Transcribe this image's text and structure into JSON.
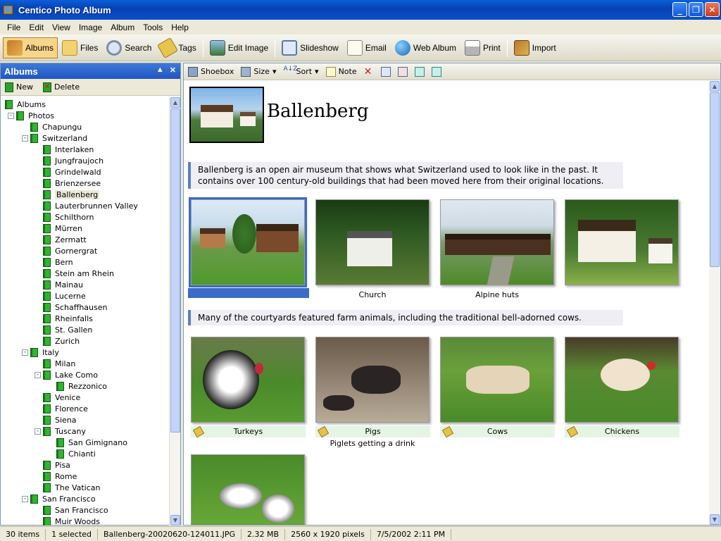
{
  "window": {
    "title": "Centico Photo Album"
  },
  "menu": [
    "File",
    "Edit",
    "View",
    "Image",
    "Album",
    "Tools",
    "Help"
  ],
  "toolbar": {
    "albums": "Albums",
    "files": "Files",
    "search": "Search",
    "tags": "Tags",
    "edit_image": "Edit Image",
    "slideshow": "Slideshow",
    "email": "Email",
    "web_album": "Web Album",
    "print": "Print",
    "import": "Import"
  },
  "left_pane": {
    "title": "Albums",
    "new_label": "New",
    "delete_label": "Delete",
    "tree": [
      {
        "label": "Albums",
        "level": 0,
        "toggle": ""
      },
      {
        "label": "Photos",
        "level": 1,
        "toggle": "-"
      },
      {
        "label": "Chapungu",
        "level": 2,
        "toggle": ""
      },
      {
        "label": "Switzerland",
        "level": 2,
        "toggle": "-"
      },
      {
        "label": "Interlaken",
        "level": 3,
        "toggle": ""
      },
      {
        "label": "Jungfraujoch",
        "level": 3,
        "toggle": ""
      },
      {
        "label": "Grindelwald",
        "level": 3,
        "toggle": ""
      },
      {
        "label": "Brienzersee",
        "level": 3,
        "toggle": ""
      },
      {
        "label": "Ballenberg",
        "level": 3,
        "toggle": "",
        "selected": true
      },
      {
        "label": "Lauterbrunnen Valley",
        "level": 3,
        "toggle": ""
      },
      {
        "label": "Schilthorn",
        "level": 3,
        "toggle": ""
      },
      {
        "label": "Mürren",
        "level": 3,
        "toggle": ""
      },
      {
        "label": "Zermatt",
        "level": 3,
        "toggle": ""
      },
      {
        "label": "Gornergrat",
        "level": 3,
        "toggle": ""
      },
      {
        "label": "Bern",
        "level": 3,
        "toggle": ""
      },
      {
        "label": "Stein am Rhein",
        "level": 3,
        "toggle": ""
      },
      {
        "label": "Mainau",
        "level": 3,
        "toggle": ""
      },
      {
        "label": "Lucerne",
        "level": 3,
        "toggle": ""
      },
      {
        "label": "Schaffhausen",
        "level": 3,
        "toggle": ""
      },
      {
        "label": "Rheinfalls",
        "level": 3,
        "toggle": ""
      },
      {
        "label": "St. Gallen",
        "level": 3,
        "toggle": ""
      },
      {
        "label": "Zurich",
        "level": 3,
        "toggle": ""
      },
      {
        "label": "Italy",
        "level": 2,
        "toggle": "-"
      },
      {
        "label": "Milan",
        "level": 3,
        "toggle": ""
      },
      {
        "label": "Lake Como",
        "level": 3,
        "toggle": "-"
      },
      {
        "label": "Rezzonico",
        "level": 4,
        "toggle": ""
      },
      {
        "label": "Venice",
        "level": 3,
        "toggle": ""
      },
      {
        "label": "Florence",
        "level": 3,
        "toggle": ""
      },
      {
        "label": "Siena",
        "level": 3,
        "toggle": ""
      },
      {
        "label": "Tuscany",
        "level": 3,
        "toggle": "-"
      },
      {
        "label": "San Gimignano",
        "level": 4,
        "toggle": ""
      },
      {
        "label": "Chianti",
        "level": 4,
        "toggle": ""
      },
      {
        "label": "Pisa",
        "level": 3,
        "toggle": ""
      },
      {
        "label": "Rome",
        "level": 3,
        "toggle": ""
      },
      {
        "label": "The Vatican",
        "level": 3,
        "toggle": ""
      },
      {
        "label": "San Francisco",
        "level": 2,
        "toggle": "-"
      },
      {
        "label": "San Francisco",
        "level": 3,
        "toggle": ""
      },
      {
        "label": "Muir Woods",
        "level": 3,
        "toggle": ""
      }
    ]
  },
  "right_toolbar": {
    "shoebox": "Shoebox",
    "size": "Size",
    "sort": "Sort",
    "note": "Note"
  },
  "album": {
    "title": "Ballenberg",
    "note1": "Ballenberg is an open air museum that shows what Switzerland used to look like in the past. It contains over 100 century-old buildings that had been moved here from their original locations.",
    "note2": "Many of the courtyards featured farm animals, including the traditional bell-adorned cows.",
    "row1_captions": [
      "",
      "Church",
      "Alpine huts",
      ""
    ],
    "row2_tags": [
      "Turkeys",
      "Pigs",
      "Cows",
      "Chickens"
    ],
    "row2_caption_pigs": "Piglets getting a drink"
  },
  "status": {
    "items": "30 items",
    "selected": "1 selected",
    "filename": "Ballenberg-20020620-124011.JPG",
    "size": "2.32 MB",
    "dims": "2560 x 1920 pixels",
    "date": "7/5/2002 2:11 PM"
  }
}
